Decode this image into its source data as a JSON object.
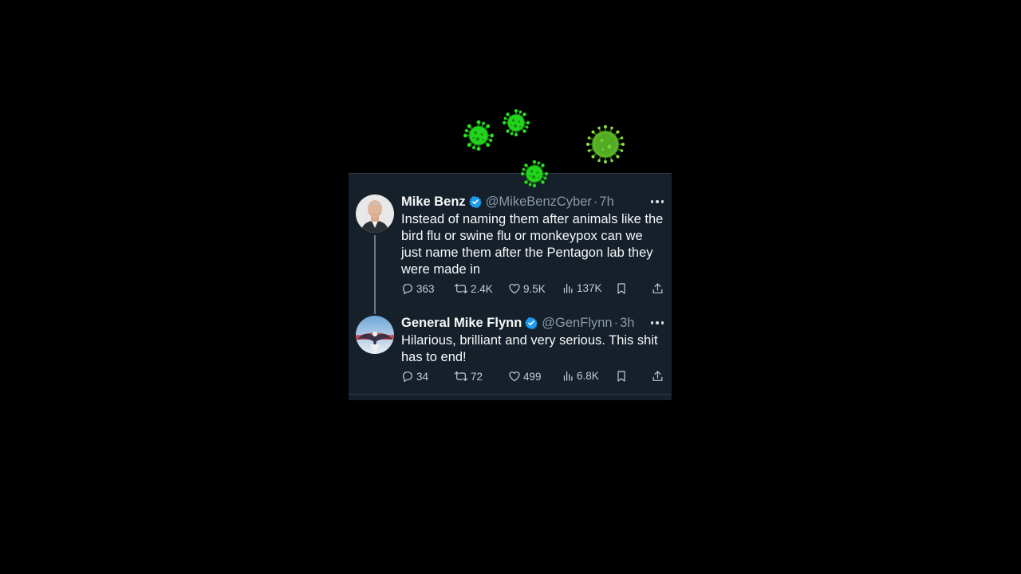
{
  "colors": {
    "page_background": "#000000",
    "card_background": "#15202b",
    "name_text": "#f7f9f9",
    "secondary_text": "#8b98a5",
    "verified_badge": "#1d9bf0",
    "virus_green": "#22d41c"
  },
  "decorations": [
    "virus-icon",
    "virus-icon",
    "virus-icon",
    "virus-icon"
  ],
  "tweets": [
    {
      "name": "Mike Benz",
      "handle": "@MikeBenzCyber",
      "separator": "·",
      "time": "7h",
      "text": "Instead of naming them after animals like the bird flu or swine flu or monkeypox can we just name them after the Pentagon lab they were made in",
      "verified": true,
      "replies": "363",
      "retweets": "2.4K",
      "likes": "9.5K",
      "views": "137K"
    },
    {
      "name": "General Mike Flynn",
      "handle": "@GenFlynn",
      "separator": "·",
      "time": "3h",
      "text": "Hilarious, brilliant and very serious. This shit has to end!",
      "verified": true,
      "replies": "34",
      "retweets": "72",
      "likes": "499",
      "views": "6.8K"
    }
  ]
}
